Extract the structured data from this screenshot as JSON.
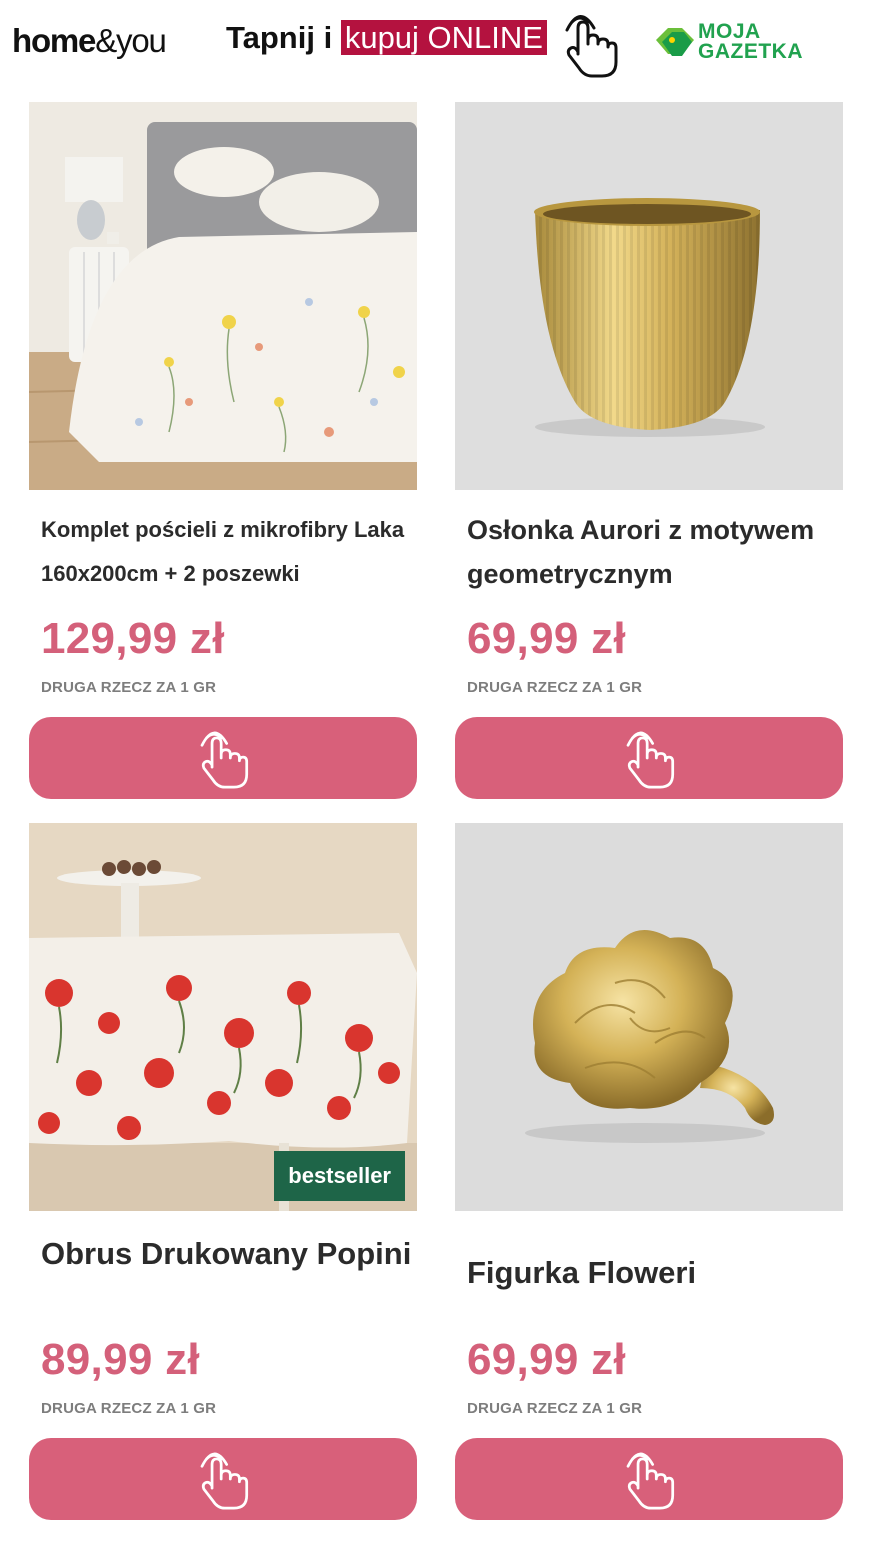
{
  "header": {
    "brand_bold": "home",
    "brand_rest": "&you",
    "tap_prefix": "Tapnij i",
    "tap_highlight": "kupuj ONLINE",
    "partner_line1": "MOJA",
    "partner_line2": "GAZETKA"
  },
  "colors": {
    "accent_pink": "#d8607a",
    "price_pink": "#d4607a",
    "highlight_red": "#b4123f",
    "partner_green": "#21a24f",
    "badge_green": "#1e6548"
  },
  "products": [
    {
      "title": "Komplet pościeli z mikrofibry Laka 160x200cm + 2 poszewki",
      "price": "129,99 zł",
      "promo": "DRUGA RZECZ ZA 1 GR",
      "image": "floral-bedding-photo",
      "button_icon": "tap-hand-icon"
    },
    {
      "title": "Osłonka Aurori z motywem geometrycznym",
      "price": "69,99 zł",
      "promo": "DRUGA RZECZ ZA 1 GR",
      "image": "gold-planter-photo",
      "button_icon": "tap-hand-icon"
    },
    {
      "title": "Obrus Drukowany Popini",
      "price": "89,99 zł",
      "promo": "DRUGA RZECZ ZA 1 GR",
      "badge": "bestseller",
      "image": "poppy-tablecloth-photo",
      "button_icon": "tap-hand-icon"
    },
    {
      "title": "Figurka Floweri",
      "price": "69,99 zł",
      "promo": "DRUGA RZECZ ZA 1 GR",
      "image": "gold-flower-figurine-photo",
      "button_icon": "tap-hand-icon"
    }
  ]
}
